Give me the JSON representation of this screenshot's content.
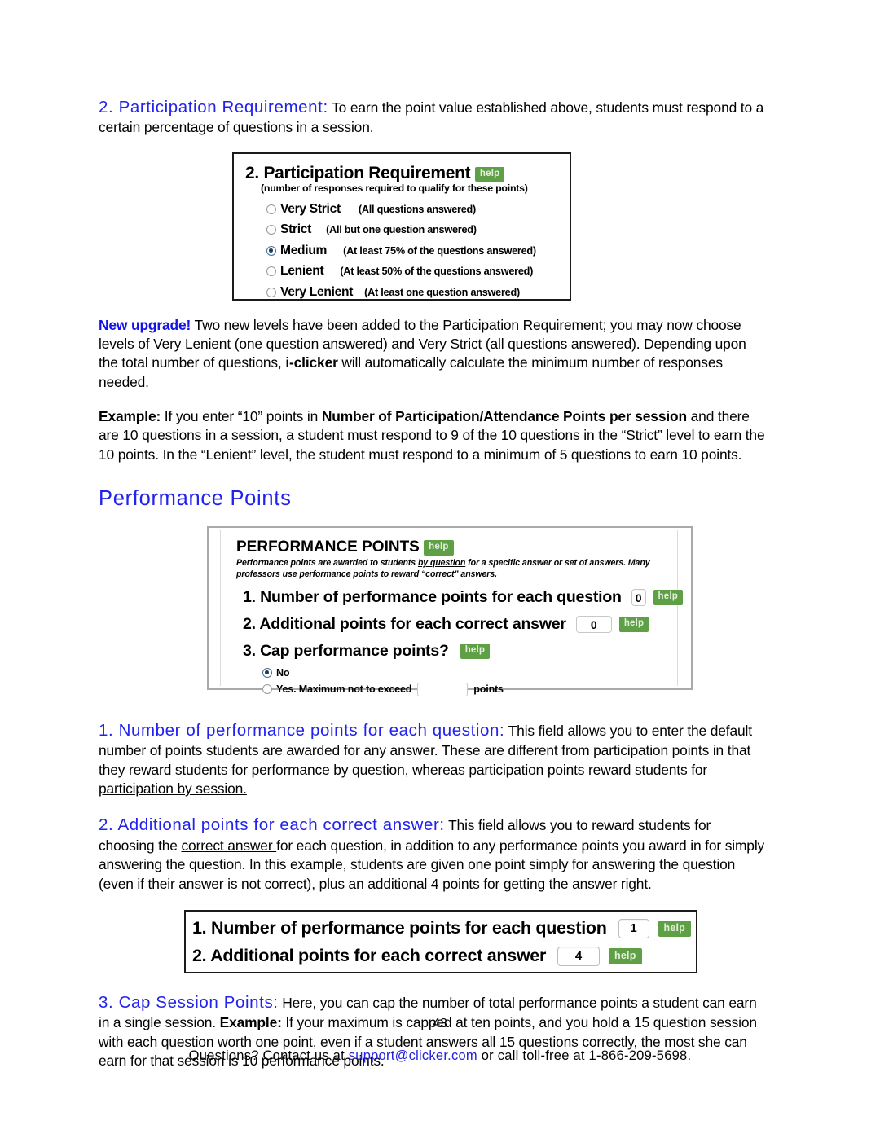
{
  "document": {
    "page_number": "43",
    "footer": {
      "before": "Questions? Contact us at ",
      "email": "support@clicker.com",
      "after": " or call toll-free at 1-866-209-5698."
    }
  },
  "participation": {
    "heading_blue": "2. Participation Requirement",
    "heading_colon": ":",
    "intro": " To earn the point value established above, students must respond to a certain percentage of questions in a session.",
    "screenshot": {
      "cutoff_text": "••  ••• ••",
      "title": "2. Participation Requirement",
      "help_label": "help",
      "subtitle": "(number of responses required to qualify for these points)",
      "options": [
        {
          "label": "Very Strict",
          "description": "(All questions answered)",
          "selected": false,
          "desc_indent": 22
        },
        {
          "label": "Strict",
          "description": "(All but one question answered)",
          "selected": false,
          "desc_indent": 18
        },
        {
          "label": "Medium",
          "description": "(At least 75% of the questions answered)",
          "selected": true,
          "desc_indent": 20
        },
        {
          "label": "Lenient",
          "description": "(At least 50% of the questions answered)",
          "selected": false,
          "desc_indent": 20
        },
        {
          "label": "Very Lenient",
          "description": "(At least one question answered)",
          "selected": false,
          "desc_indent": 14
        }
      ]
    },
    "new_upgrade": {
      "tag": "New upgrade!",
      "text_1": " Two new levels have been added to the Participation Requirement; you may now choose levels of Very Lenient (one question answered) and Very Strict (all questions answered). Depending upon the total number of questions, ",
      "bold_1": "i-clicker",
      "text_2": " will automatically calculate the minimum number of responses needed."
    },
    "example": {
      "tag": "Example:",
      "text_1": " If you enter “10” points in ",
      "bold_1": "Number of Participation/Attendance Points per session",
      "text_2": " and there are 10 questions in a session, a student must respond to 9 of the 10 questions in the “Strict” level to earn the 10 points. In the “Lenient” level, the student must respond to a minimum of 5 questions to earn 10 points."
    }
  },
  "performance": {
    "section_heading": "Performance Points",
    "screenshot": {
      "title": "PERFORMANCE POINTS",
      "help_label": "help",
      "note_before": "Performance points are awarded to students ",
      "note_underline": "by question",
      "note_after": " for a specific answer or set of answers. Many professors use performance points to reward “correct” answers.",
      "rows": [
        {
          "label": "1. Number of performance points for each question",
          "value": "0",
          "help_label": "help"
        },
        {
          "label": "2. Additional points for each correct answer",
          "value": "0",
          "help_label": "help"
        },
        {
          "label": "3. Cap performance points?",
          "value": null,
          "help_label": "help"
        }
      ],
      "cap_options": [
        {
          "label": "No",
          "selected": true
        },
        {
          "label": "Yes. Maximum not to exceed",
          "selected": false,
          "suffix": "points",
          "input_value": ""
        }
      ]
    },
    "item1": {
      "heading_blue": "1. Number of performance points for each question",
      "heading_colon": ":",
      "text_1": " This field allows you to enter the default number of points students are awarded for any answer. These are different from participation points in that they reward students for ",
      "underline_1": "performance by question",
      "text_2": ", whereas participation points reward students for ",
      "underline_2": "participation by session.",
      "text_3": ""
    },
    "item2": {
      "heading_blue": "2. Additional points for each correct answer",
      "heading_colon": ":",
      "text_1": " This field allows you to reward students for choosing the ",
      "underline_1": "correct answer ",
      "text_2": "for each question, in addition to any performance points you award in for simply answering the question. In this example, students are given one point simply for answering the question (even if their answer is not correct), plus an additional 4 points for getting the answer right."
    },
    "screenshot_filled": {
      "rows": [
        {
          "label": "1. Number of performance points for each question",
          "value": "1",
          "help_label": "help"
        },
        {
          "label": "2. Additional points for each correct answer",
          "value": "4",
          "help_label": "help"
        }
      ]
    },
    "item3": {
      "heading_blue": "3. Cap Session Points",
      "heading_colon": ":",
      "text_1": " Here, you can cap the number of total performance points a student can earn in a single session. ",
      "bold_1": "Example:",
      "text_2": " If your maximum is capped at ten points, and you hold a 15 question session with each question worth one point, even if a student answers all 15 questions correctly, the most she can earn for that session is 10 performance points."
    }
  },
  "colors": {
    "heading_blue": "#2222ee",
    "help_badge_green": "#5fa046",
    "link_blue": "#2222dd"
  }
}
